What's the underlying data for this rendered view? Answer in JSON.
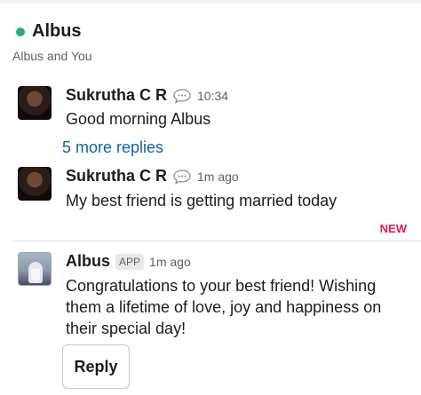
{
  "channel": {
    "name": "Albus",
    "subtitle": "Albus and You",
    "presence_color": "#2bac76"
  },
  "messages": [
    {
      "author": "Sukrutha C R",
      "status_icon": "speech-bubble-icon",
      "timestamp": "10:34",
      "text": "Good morning Albus",
      "thread_link": "5 more replies"
    },
    {
      "author": "Sukrutha C R",
      "status_icon": "speech-bubble-icon",
      "timestamp": "1m ago",
      "text": "My best friend is getting married today"
    },
    {
      "author": "Albus",
      "badge": "APP",
      "timestamp": "1m ago",
      "text_lines": [
        "Congratulations to your best friend! Wishing",
        "them a lifetime of love, joy and happiness on",
        "their special day!"
      ],
      "button_label": "Reply"
    }
  ],
  "new_divider_label": "NEW",
  "colors": {
    "link": "#1264a3",
    "new_marker": "#e01e5a",
    "timestamp": "#616061"
  }
}
